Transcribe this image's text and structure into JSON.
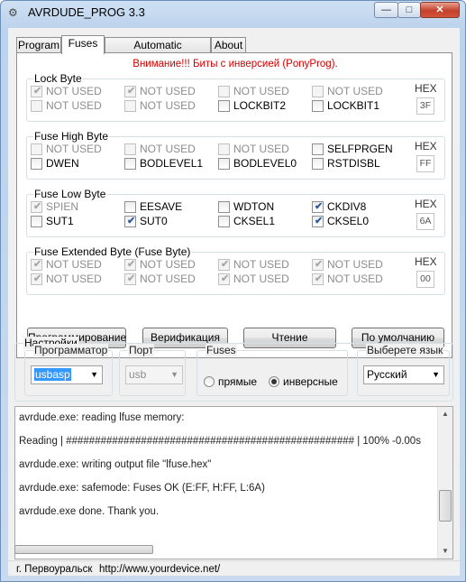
{
  "window": {
    "title": "AVRDUDE_PROG 3.3",
    "min_icon": "minimize-icon",
    "max_icon": "maximize-icon",
    "close_icon": "close-icon"
  },
  "tabs": [
    {
      "label": "Program"
    },
    {
      "label": "Fuses"
    },
    {
      "label": "Automatic programming"
    },
    {
      "label": "About"
    }
  ],
  "warning": "Внимание!!! Биты с инверсией (PonyProg).",
  "groups": [
    {
      "title": "Lock Byte",
      "hex_label": "HEX",
      "hex_value": "3F",
      "bits": [
        {
          "label": "NOT USED",
          "checked": true,
          "disabled": true
        },
        {
          "label": "NOT USED",
          "checked": true,
          "disabled": true
        },
        {
          "label": "NOT USED",
          "checked": false,
          "disabled": true
        },
        {
          "label": "NOT USED",
          "checked": false,
          "disabled": true
        },
        {
          "label": "NOT USED",
          "checked": false,
          "disabled": true
        },
        {
          "label": "NOT USED",
          "checked": false,
          "disabled": true
        },
        {
          "label": "LOCKBIT2",
          "checked": false,
          "disabled": false
        },
        {
          "label": "LOCKBIT1",
          "checked": false,
          "disabled": false
        }
      ]
    },
    {
      "title": "Fuse High Byte",
      "hex_label": "HEX",
      "hex_value": "FF",
      "bits": [
        {
          "label": "NOT USED",
          "checked": false,
          "disabled": true
        },
        {
          "label": "NOT USED",
          "checked": false,
          "disabled": true
        },
        {
          "label": "NOT USED",
          "checked": false,
          "disabled": true
        },
        {
          "label": "SELFPRGEN",
          "checked": false,
          "disabled": false
        },
        {
          "label": "DWEN",
          "checked": false,
          "disabled": false
        },
        {
          "label": "BODLEVEL1",
          "checked": false,
          "disabled": false
        },
        {
          "label": "BODLEVEL0",
          "checked": false,
          "disabled": false
        },
        {
          "label": "RSTDISBL",
          "checked": false,
          "disabled": false
        }
      ]
    },
    {
      "title": "Fuse Low Byte",
      "hex_label": "HEX",
      "hex_value": "6A",
      "bits": [
        {
          "label": "SPIEN",
          "checked": true,
          "disabled": true
        },
        {
          "label": "EESAVE",
          "checked": false,
          "disabled": false
        },
        {
          "label": "WDTON",
          "checked": false,
          "disabled": false
        },
        {
          "label": "CKDIV8",
          "checked": true,
          "disabled": false
        },
        {
          "label": "SUT1",
          "checked": false,
          "disabled": false
        },
        {
          "label": "SUT0",
          "checked": true,
          "disabled": false
        },
        {
          "label": "CKSEL1",
          "checked": false,
          "disabled": false
        },
        {
          "label": "CKSEL0",
          "checked": true,
          "disabled": false
        }
      ]
    },
    {
      "title": "Fuse Extended Byte (Fuse Byte)",
      "hex_label": "HEX",
      "hex_value": "00",
      "bits": [
        {
          "label": "NOT USED",
          "checked": true,
          "disabled": true
        },
        {
          "label": "NOT USED",
          "checked": true,
          "disabled": true
        },
        {
          "label": "NOT USED",
          "checked": true,
          "disabled": true
        },
        {
          "label": "NOT USED",
          "checked": true,
          "disabled": true
        },
        {
          "label": "NOT USED",
          "checked": true,
          "disabled": true
        },
        {
          "label": "NOT USED",
          "checked": true,
          "disabled": true
        },
        {
          "label": "NOT USED",
          "checked": true,
          "disabled": true
        },
        {
          "label": "NOT USED",
          "checked": true,
          "disabled": true
        }
      ]
    }
  ],
  "buttons": {
    "program": "Программирование",
    "verify": "Верификация",
    "read": "Чтение",
    "default": "По умолчанию"
  },
  "settings": {
    "title": "Настройки",
    "programmer": {
      "label": "Программатор",
      "value": "usbasp"
    },
    "port": {
      "label": "Порт",
      "value": "usb"
    },
    "fuses": {
      "label": "Fuses",
      "opt1": "прямые",
      "opt2": "инверсные",
      "selected": "инверсные"
    },
    "language": {
      "label": "Выберете язык",
      "value": "Русский"
    }
  },
  "log": [
    "avrdude.exe: reading lfuse memory:",
    "Reading | ################################################## | 100% -0.00s",
    "avrdude.exe: writing output file \"lfuse.hex\"",
    "avrdude.exe: safemode: Fuses OK (E:FF, H:FF, L:6A)",
    "avrdude.exe done.  Thank you."
  ],
  "status": {
    "city": "г. Первоуральск",
    "url": "http://www.yourdevice.net/"
  }
}
